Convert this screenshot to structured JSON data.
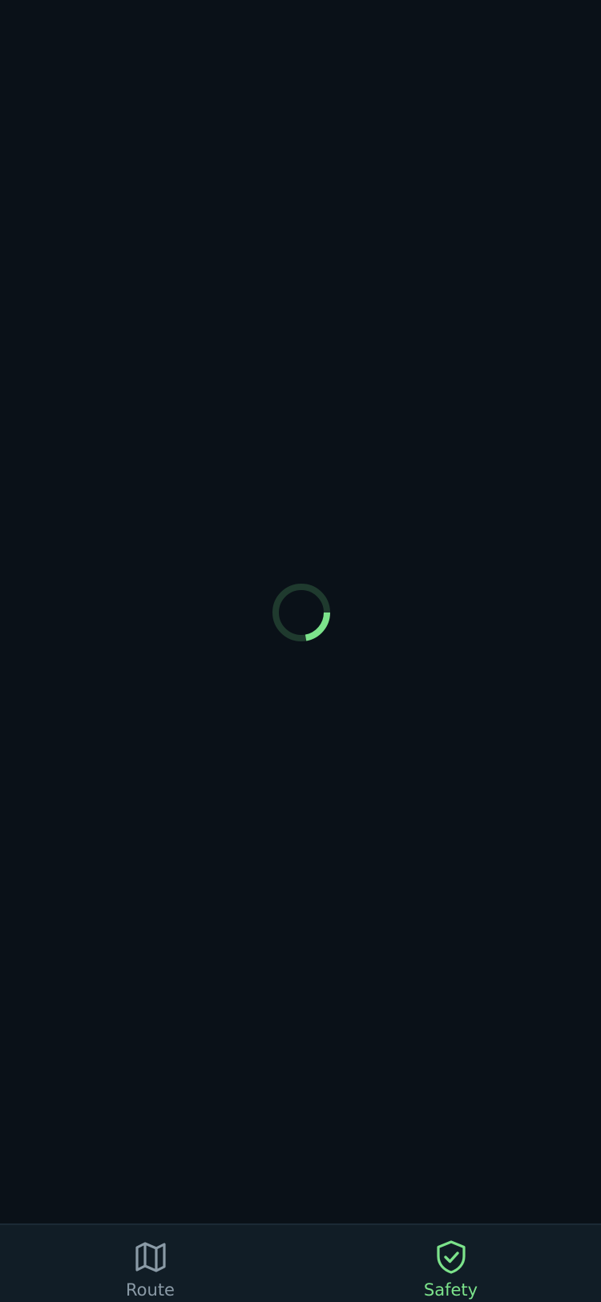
{
  "theme": {
    "background": "#0a1118",
    "tabbar_background": "#111d26",
    "active_color": "#7ce38b",
    "inactive_color": "#8a9aa6",
    "spinner_track": "#1f3a2e"
  },
  "loader": {
    "icon": "loading-spinner-icon"
  },
  "tabbar": {
    "tabs": [
      {
        "label": "Route",
        "icon": "map-icon",
        "active": false
      },
      {
        "label": "Safety",
        "icon": "shield-check-icon",
        "active": true
      }
    ]
  }
}
